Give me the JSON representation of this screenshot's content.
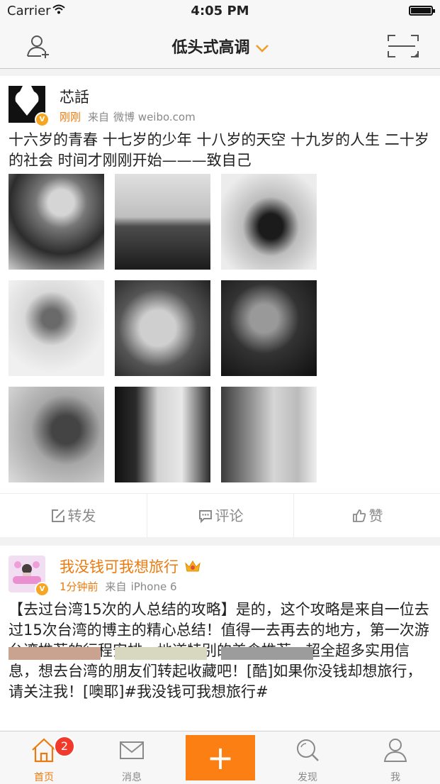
{
  "status_bar": {
    "carrier": "Carrier",
    "time": "4:05 PM",
    "battery_level": 1.0
  },
  "nav": {
    "title": "低头式高调",
    "add_friend_icon": "add-friend-icon",
    "scan_icon": "scan-icon",
    "dropdown_icon": "chevron-down-icon"
  },
  "posts": [
    {
      "name": "芯話",
      "time": "刚刚",
      "source_prefix": "来自",
      "source": "微博 weibo.com",
      "verified": "V",
      "text": "十六岁的青春 十七岁的少年 十八岁的天空 十九岁的人生 二十岁的社会 时间才刚刚开始———致自己",
      "photo_count": 9,
      "actions": {
        "repost": "转发",
        "comment": "评论",
        "like": "赞"
      }
    },
    {
      "name": "我没钱可我想旅行",
      "time": "1分钟前",
      "source_prefix": "来自",
      "source": "iPhone 6",
      "verified": "V",
      "crown_icon": "crown-icon",
      "text": "【去过台湾15次的人总结的攻略】是的，这个攻略是来自一位去过15次台湾的博主的精心总结！值得一去再去的地方，第一次游台湾推荐的行程安排，地道特别的美食推荐...超全超多实用信息，想去台湾的朋友们转起收藏吧！[酷]如果你没钱却想旅行，请关注我！[噢耶]#我没钱可我想旅行#"
    }
  ],
  "tabbar": {
    "home": "首页",
    "home_badge": "2",
    "messages": "消息",
    "compose": "+",
    "discover": "发现",
    "me": "我"
  },
  "colors": {
    "accent": "#ec7b0f",
    "compose_bg": "#fb7f12",
    "badge": "#f23a2c"
  }
}
